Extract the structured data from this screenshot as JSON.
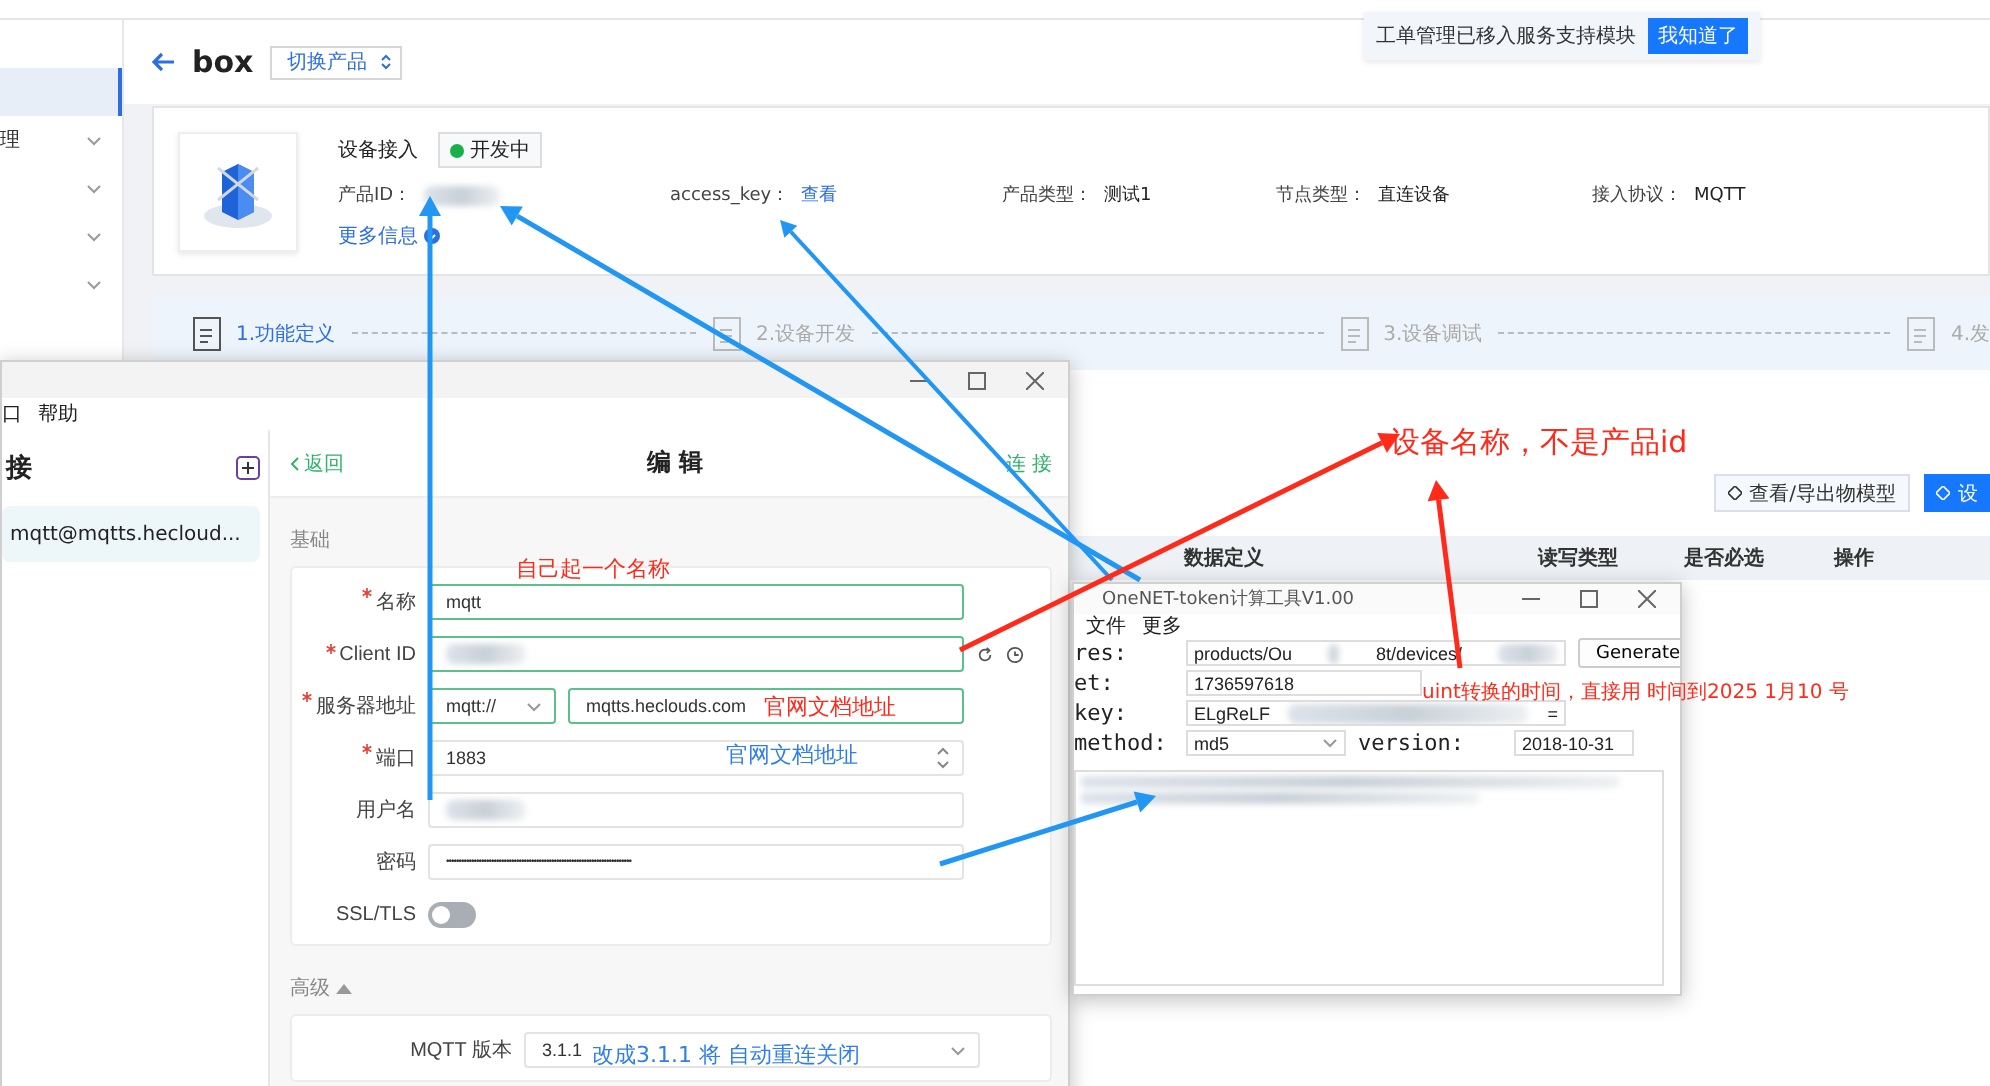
{
  "tooltip": {
    "text": "工单管理已移入服务支持模块",
    "button": "我知道了"
  },
  "sidebar": {
    "items": [
      {
        "selected": true,
        "expandable": false
      },
      {
        "label": "理",
        "selected": false,
        "expandable": true
      },
      {
        "selected": false,
        "expandable": true
      },
      {
        "selected": false,
        "expandable": true
      },
      {
        "selected": false,
        "expandable": true
      }
    ]
  },
  "header": {
    "title": "box",
    "switch_button": "切换产品"
  },
  "product": {
    "name": "设备接入",
    "status": "开发中",
    "more_link": "更多信息",
    "fields": [
      {
        "label": "产品ID：",
        "kind": "blurred"
      },
      {
        "label": "access_key：",
        "value": "查看",
        "kind": "link"
      },
      {
        "label": "产品类型：",
        "value": "测试1",
        "kind": "text"
      },
      {
        "label": "节点类型：",
        "value": "直连设备",
        "kind": "text"
      },
      {
        "label": "接入协议：",
        "value": "MQTT",
        "kind": "text"
      }
    ]
  },
  "steps": [
    {
      "label": "1.功能定义",
      "selected": true
    },
    {
      "label": "2.设备开发",
      "selected": false
    },
    {
      "label": "3.设备调试",
      "selected": false
    },
    {
      "label": "4.发",
      "selected": false
    }
  ],
  "toolbar": {
    "buttons": [
      {
        "label": "查看/导出物模型",
        "kind": "secondary"
      },
      {
        "label": "设",
        "kind": "primary"
      }
    ]
  },
  "table": {
    "columns": [
      "数据定义",
      "读写类型",
      "是否必选",
      "操作"
    ]
  },
  "mqttx": {
    "menu": [
      "口",
      "帮助"
    ],
    "sidebar_title": "接",
    "connections": [
      {
        "label": "mqtt@mqtts.hecloud...",
        "selected": true
      }
    ],
    "back": "返回",
    "title": "编 辑",
    "connect": "连 接",
    "basic_title": "基础",
    "advanced_title": "高级",
    "advanced_expanded": true,
    "fields": [
      {
        "label": "名称",
        "required": true,
        "kind": "text",
        "value": "mqtt"
      },
      {
        "label": "Client ID",
        "required": true,
        "kind": "client_id"
      },
      {
        "label": "服务器地址",
        "required": true,
        "kind": "address",
        "protocol": "mqtt://",
        "value": "mqtts.heclouds.com"
      },
      {
        "label": "端口",
        "required": true,
        "kind": "number",
        "value": "1883"
      },
      {
        "label": "用户名",
        "required": false,
        "kind": "blurred"
      },
      {
        "label": "密码",
        "required": false,
        "kind": "password",
        "value": "••••••••••••••••••••••••••••••••••••••••••••••••••••••••••••••••••••••••••"
      },
      {
        "label": "SSL/TLS",
        "required": false,
        "kind": "toggle",
        "on": false
      }
    ],
    "advanced_fields": [
      {
        "label": "MQTT 版本",
        "value": "3.1.1",
        "kind": "select"
      }
    ]
  },
  "token_tool": {
    "title": "OneNET-token计算工具V1.00",
    "menu": [
      "文件",
      "更多"
    ],
    "res": {
      "label": "res:",
      "value_start": "products/Ou",
      "value_end": "8t/devices/"
    },
    "et": {
      "label": "et:",
      "value": "1736597618"
    },
    "key": {
      "label": "key:",
      "value_start": "ELgReLF",
      "value_end": "="
    },
    "method": {
      "label": "method:",
      "value": "md5"
    },
    "version": {
      "label": "version:",
      "value": "2018-10-31"
    },
    "generate": "Generate"
  },
  "annotations": [
    {
      "text": "设备名称，不是产品id",
      "color": "#ff2a1a"
    },
    {
      "text": "自己起一个名称",
      "color": "#ff2a1a"
    },
    {
      "text": "uint转换的时间，直接用  时间到2025 1月10 号",
      "color": "#ff2a1a"
    },
    {
      "text": "官网文档地址",
      "color": "#ff2a1a"
    },
    {
      "text": "官网文档地址",
      "color": "#2f7fe8"
    },
    {
      "text": "改成3.1.1 将 自动重连关闭",
      "color": "#2f7fe8"
    }
  ]
}
